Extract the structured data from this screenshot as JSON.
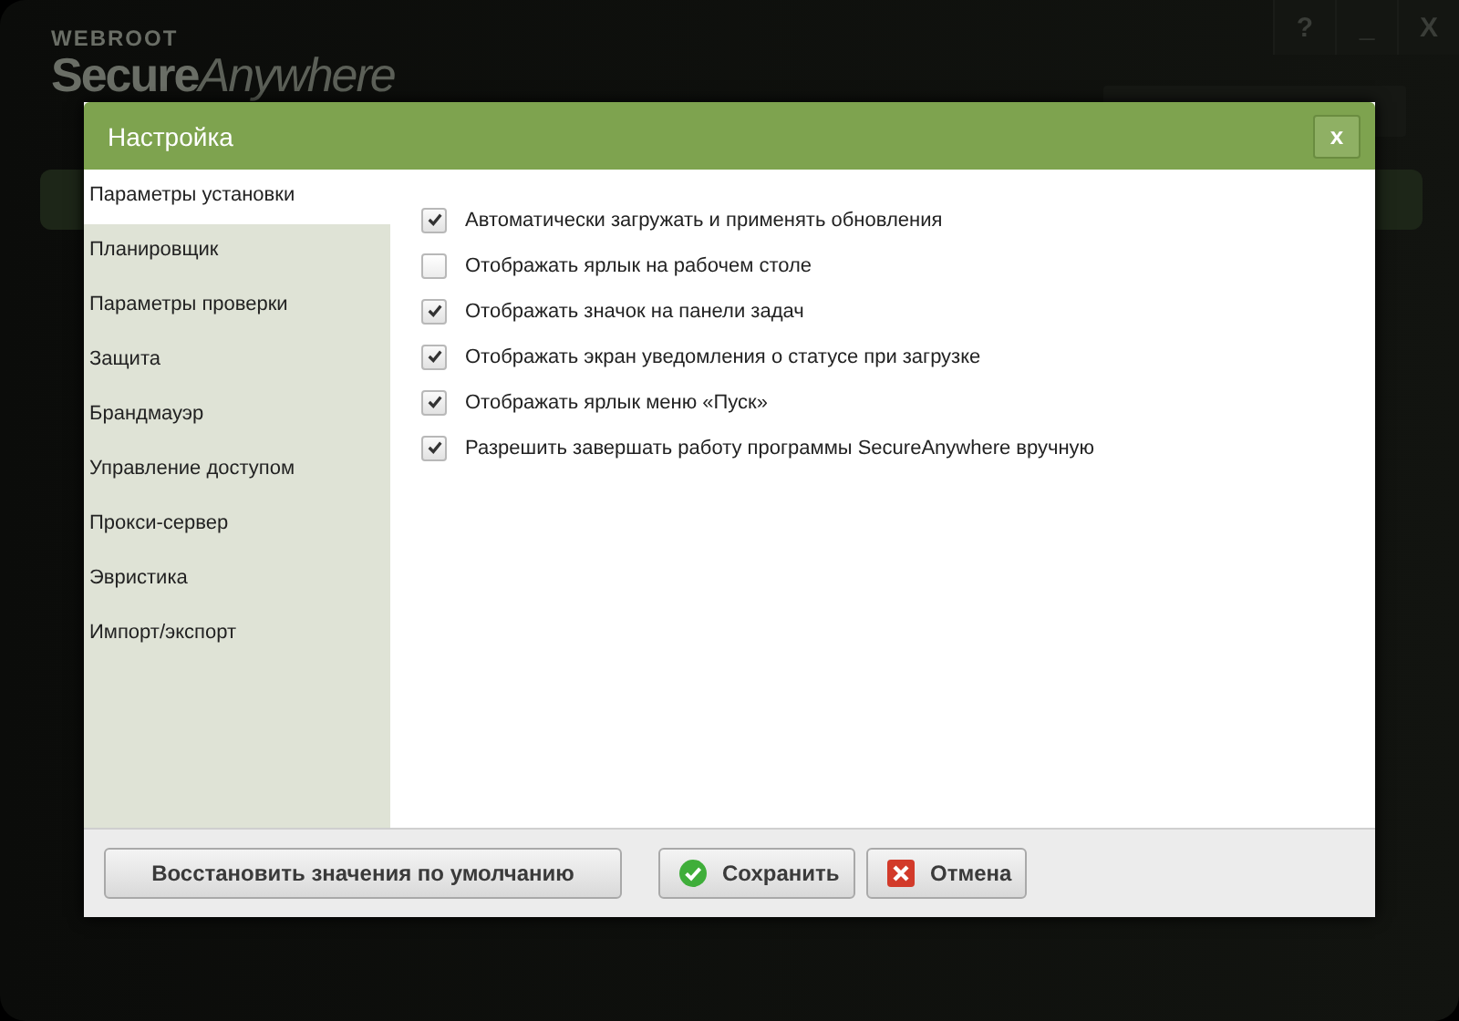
{
  "app": {
    "brand": "WEBROOT",
    "product_bold": "Secure",
    "product_light": "Anywhere",
    "window_buttons": [
      "?",
      "_",
      "X"
    ]
  },
  "dialog": {
    "title": "Настройка",
    "close": "x"
  },
  "sidebar": {
    "items": [
      {
        "label": "Параметры установки",
        "selected": true
      },
      {
        "label": "Планировщик",
        "selected": false
      },
      {
        "label": "Параметры проверки",
        "selected": false
      },
      {
        "label": "Защита",
        "selected": false
      },
      {
        "label": "Брандмауэр",
        "selected": false
      },
      {
        "label": "Управление доступом",
        "selected": false
      },
      {
        "label": "Прокси-сервер",
        "selected": false
      },
      {
        "label": "Эвристика",
        "selected": false
      },
      {
        "label": "Импорт/экспорт",
        "selected": false
      }
    ]
  },
  "options": [
    {
      "label": "Автоматически загружать и применять обновления",
      "checked": true
    },
    {
      "label": "Отображать ярлык на рабочем столе",
      "checked": false
    },
    {
      "label": "Отображать значок на панели задач",
      "checked": true
    },
    {
      "label": "Отображать экран уведомления о статусе при загрузке",
      "checked": true
    },
    {
      "label": "Отображать ярлык меню «Пуск»",
      "checked": true
    },
    {
      "label": "Разрешить завершать работу программы SecureAnywhere вручную",
      "checked": true
    }
  ],
  "buttons": [
    {
      "label": "Восстановить значения по умолчанию",
      "kind": "plain"
    },
    {
      "label": "Сохранить",
      "kind": "save"
    },
    {
      "label": "Отмена",
      "kind": "cancel"
    }
  ]
}
